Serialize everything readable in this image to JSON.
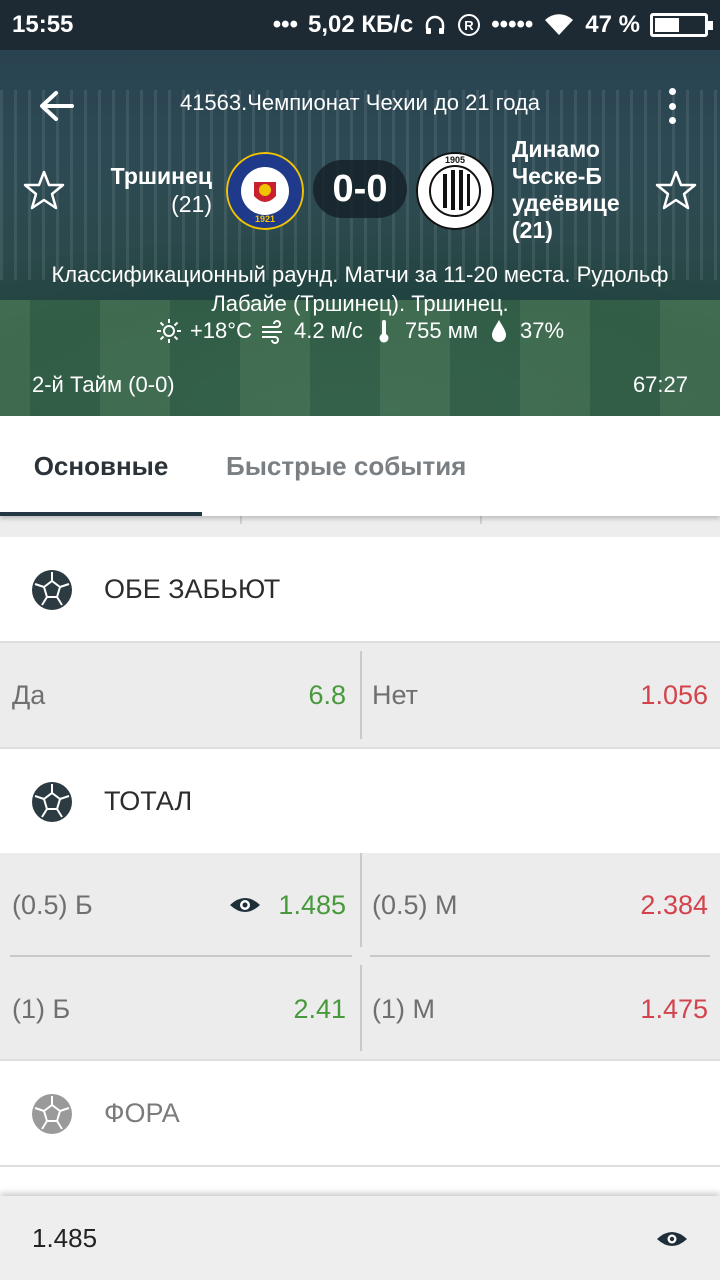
{
  "status_bar": {
    "time": "15:55",
    "speed": "5,02 КБ/с",
    "battery_percent": "47 %",
    "battery_level": 0.47
  },
  "match": {
    "league": "41563.Чемпионат Чехии до 21 года",
    "home_team": "Тршинец",
    "home_team_age": "(21)",
    "away_team_lines": [
      "Динамо",
      "Ческе-Б",
      "удеёвице",
      "(21)"
    ],
    "score": "0-0",
    "info_line1": "Классификационный раунд. Матчи за 11-20 места. Рудольф",
    "info_line2": "Лабайе (Тршинец). Тршинец.",
    "weather": {
      "temperature": "+18°C",
      "wind": "4.2 м/с",
      "pressure": "755 мм",
      "humidity": "37%"
    },
    "period": "2-й  Тайм (0-0)",
    "clock": "67:27"
  },
  "logos": {
    "home_top_text": "FK FOTBAL TŘINEC",
    "home_year": "1921",
    "away_year": "1905",
    "away_ring_text": "SK DYNAMO ČESKÉ BUDĚJOVICE"
  },
  "tabs": [
    {
      "label": "Основные",
      "active": true
    },
    {
      "label": "Быстрые события",
      "active": false
    }
  ],
  "markets": {
    "both_score": {
      "title": "ОБЕ ЗАБЬЮТ",
      "left": {
        "label": "Да",
        "odd": "6.8"
      },
      "right": {
        "label": "Нет",
        "odd": "1.056"
      }
    },
    "total": {
      "title": "ТОТАЛ",
      "rows": [
        {
          "left_label": "(0.5) Б",
          "left_odd": "1.485",
          "right_label": "(0.5) М",
          "right_odd": "2.384"
        },
        {
          "left_label": "(1) Б",
          "left_odd": "2.41",
          "right_label": "(1) М",
          "right_odd": "1.475"
        }
      ]
    },
    "handicap": {
      "title": "ФОРА"
    }
  },
  "bottom_bar": {
    "value": "1.485"
  },
  "colors": {
    "green": "#479a3c",
    "red": "#d2434c",
    "dark": "#243844"
  }
}
